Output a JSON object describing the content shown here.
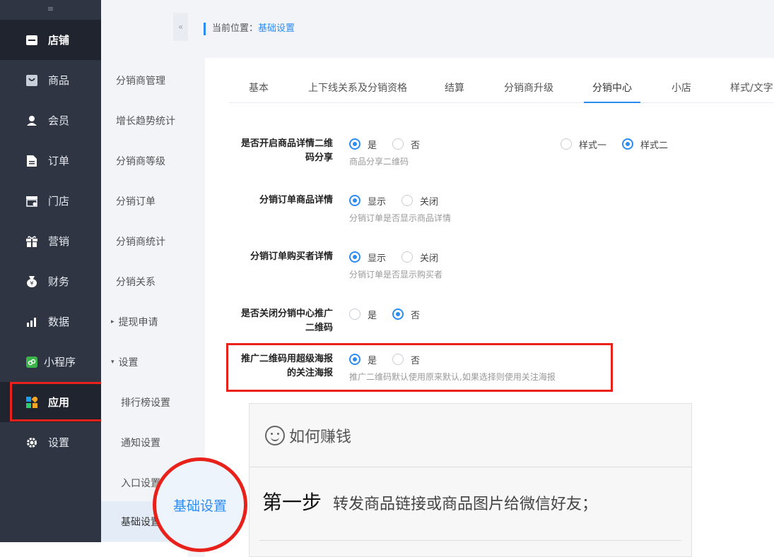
{
  "sidebar": {
    "collapse_glyph": "≡",
    "items": [
      {
        "label": "店铺",
        "icon": "store-icon"
      },
      {
        "label": "商品",
        "icon": "goods-icon"
      },
      {
        "label": "会员",
        "icon": "member-icon"
      },
      {
        "label": "订单",
        "icon": "order-icon"
      },
      {
        "label": "门店",
        "icon": "shop-icon"
      },
      {
        "label": "营销",
        "icon": "gift-icon"
      },
      {
        "label": "财务",
        "icon": "finance-icon"
      },
      {
        "label": "数据",
        "icon": "chart-icon"
      },
      {
        "label": "小程序",
        "icon": "miniapp-icon"
      },
      {
        "label": "应用",
        "icon": "apps-icon"
      },
      {
        "label": "设置",
        "icon": "gear-icon"
      }
    ]
  },
  "subnav": {
    "items": [
      {
        "label": "分销商管理"
      },
      {
        "label": "增长趋势统计"
      },
      {
        "label": "分销商等级"
      },
      {
        "label": "分销订单"
      },
      {
        "label": "分销商统计"
      },
      {
        "label": "分销关系"
      },
      {
        "label": "提现申请",
        "arrow": "▸"
      },
      {
        "label": "设置",
        "arrow": "▾"
      },
      {
        "label": "排行榜设置"
      },
      {
        "label": "通知设置"
      },
      {
        "label": "入口设置"
      },
      {
        "label": "基础设置"
      }
    ],
    "collapse_glyph": "«"
  },
  "breadcrumb": {
    "prefix": "当前位置：",
    "current": "基础设置"
  },
  "tabs": [
    "基本",
    "上下线关系及分销资格",
    "结算",
    "分销商升级",
    "分销中心",
    "小店",
    "样式/文字"
  ],
  "settings": [
    {
      "label_line1": "是否开启商品详情二维",
      "label_line2": "码分享",
      "opt_a": "是",
      "opt_b": "否",
      "hint": "商品分享二维码",
      "style_a": "样式一",
      "style_b": "样式二"
    },
    {
      "label": "分销订单商品详情",
      "opt_a": "显示",
      "opt_b": "关闭",
      "hint": "分销订单是否显示商品详情"
    },
    {
      "label": "分销订单购买者详情",
      "opt_a": "显示",
      "opt_b": "关闭",
      "hint": "分销订单是否显示购买者"
    },
    {
      "label_line1": "是否关闭分销中心推广",
      "label_line2": "二维码",
      "opt_a": "是",
      "opt_b": "否"
    },
    {
      "label_line1": "推广二维码用超级海报",
      "label_line2": "的关注海报",
      "opt_a": "是",
      "opt_b": "否",
      "hint": "推广二维码默认使用原来默认,如果选择则使用关注海报"
    }
  ],
  "howto": {
    "heading": "如何赚钱",
    "step_title": "第一步",
    "step_text": "转发商品链接或商品图片给微信好友；"
  },
  "zoom_label": "基础设置",
  "colors": {
    "accent": "#2d8cf0",
    "highlight": "#e8211a",
    "sidebar": "#2f3542"
  }
}
